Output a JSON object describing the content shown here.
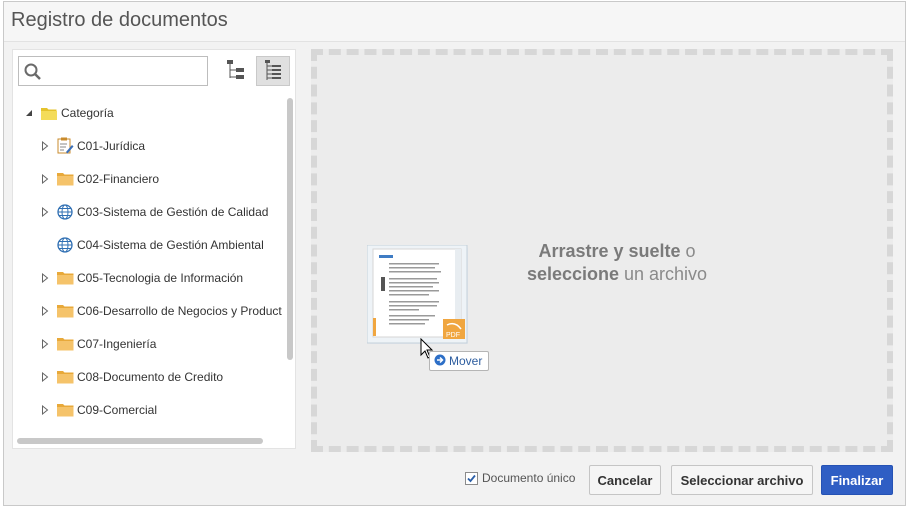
{
  "dialog": {
    "title": "Registro de documentos"
  },
  "search": {
    "value": "",
    "placeholder": ""
  },
  "toolbar": {
    "buttons": [
      {
        "icon": "tree-collapsed-icon",
        "active": false
      },
      {
        "icon": "tree-expanded-icon",
        "active": true
      }
    ]
  },
  "tree": {
    "root": {
      "label": "Categoría",
      "icon": "folder-open-icon",
      "expanded": true
    },
    "items": [
      {
        "label": "C01-Jurídica",
        "icon": "document-edit-icon",
        "has_children": true
      },
      {
        "label": "C02-Financiero",
        "icon": "folder-icon",
        "has_children": true
      },
      {
        "label": "C03-Sistema de Gestión de Calidad",
        "icon": "globe-icon",
        "has_children": true
      },
      {
        "label": "C04-Sistema de Gestión Ambiental",
        "icon": "globe-icon",
        "has_children": false
      },
      {
        "label": "C05-Tecnologia de Información",
        "icon": "folder-icon",
        "has_children": true
      },
      {
        "label": "C06-Desarrollo de Negocios y Product",
        "icon": "folder-icon",
        "has_children": true
      },
      {
        "label": "C07-Ingeniería",
        "icon": "folder-icon",
        "has_children": true
      },
      {
        "label": "C08-Documento de Credito",
        "icon": "folder-icon",
        "has_children": true
      },
      {
        "label": "C09-Comercial",
        "icon": "folder-icon",
        "has_children": true
      }
    ]
  },
  "dropzone": {
    "line1_bold": "Arrastre y suelte",
    "line1_rest": " o",
    "line2_bold": "seleccione",
    "line2_rest": " un archivo",
    "drag_tooltip": "Mover",
    "thumbnail_icon": "pdf-document-icon"
  },
  "footer": {
    "single_document_label": "Documento único",
    "single_document_checked": true,
    "cancel_label": "Cancelar",
    "select_file_label": "Seleccionar archivo",
    "finish_label": "Finalizar"
  },
  "colors": {
    "primary": "#2f5ec4",
    "folder": "#f2b94d",
    "globe": "#2f6fb3"
  }
}
